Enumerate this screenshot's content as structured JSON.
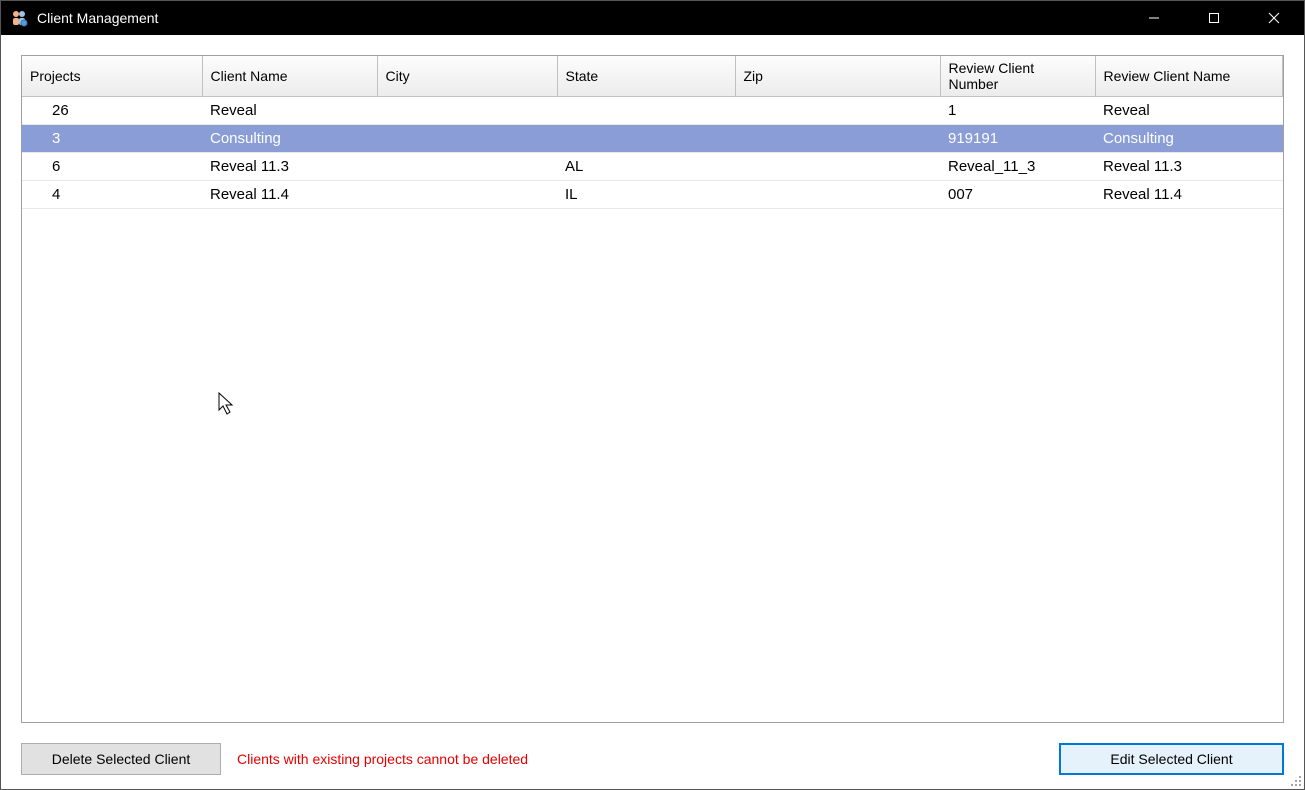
{
  "window": {
    "title": "Client Management"
  },
  "table": {
    "headers": {
      "projects": "Projects",
      "clientName": "Client Name",
      "city": "City",
      "state": "State",
      "zip": "Zip",
      "reviewClientNumber": "Review Client Number",
      "reviewClientName": "Review Client Name"
    },
    "rows": [
      {
        "projects": "26",
        "clientName": "Reveal",
        "city": "",
        "state": "",
        "zip": "",
        "reviewClientNumber": "1",
        "reviewClientName": "Reveal",
        "selected": false
      },
      {
        "projects": "3",
        "clientName": "Consulting",
        "city": "",
        "state": "",
        "zip": "",
        "reviewClientNumber": "919191",
        "reviewClientName": "Consulting",
        "selected": true
      },
      {
        "projects": "6",
        "clientName": "Reveal 11.3",
        "city": "",
        "state": "AL",
        "zip": "",
        "reviewClientNumber": "Reveal_11_3",
        "reviewClientName": "Reveal 11.3",
        "selected": false
      },
      {
        "projects": "4",
        "clientName": "Reveal 11.4",
        "city": "",
        "state": "IL",
        "zip": "",
        "reviewClientNumber": "007",
        "reviewClientName": "Reveal 11.4",
        "selected": false
      }
    ]
  },
  "buttons": {
    "delete": "Delete Selected Client",
    "edit": "Edit Selected Client"
  },
  "status": {
    "message": "Clients with existing projects cannot be deleted"
  }
}
